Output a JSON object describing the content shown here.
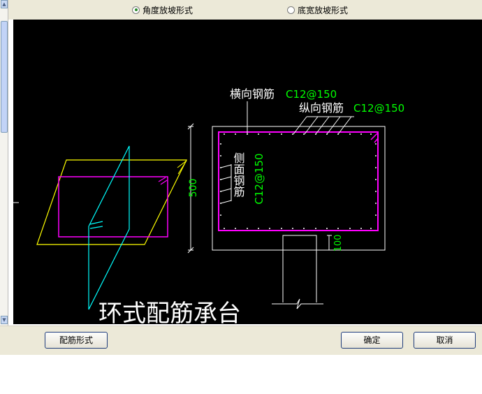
{
  "options": {
    "angle_slope": "角度放坡形式",
    "width_slope": "底宽放坡形式",
    "selected": "angle_slope"
  },
  "drawing": {
    "transverse_label": "横向钢筋",
    "transverse_spec": "C12@150",
    "longitudinal_label": "纵向钢筋",
    "longitudinal_spec": "C12@150",
    "side_label": "侧面钢筋",
    "side_spec": "C12@150",
    "height_dim": "500",
    "bottom_dim": "100",
    "title": "环式配筋承台"
  },
  "buttons": {
    "reinforce_form": "配筋形式",
    "ok": "确定",
    "cancel": "取消"
  },
  "colors": {
    "canvas_bg": "#000000",
    "white_text": "#ffffff",
    "green_text": "#00ff00",
    "magenta": "#ff00ff",
    "yellow": "#ffff00",
    "cyan": "#00ffff"
  }
}
